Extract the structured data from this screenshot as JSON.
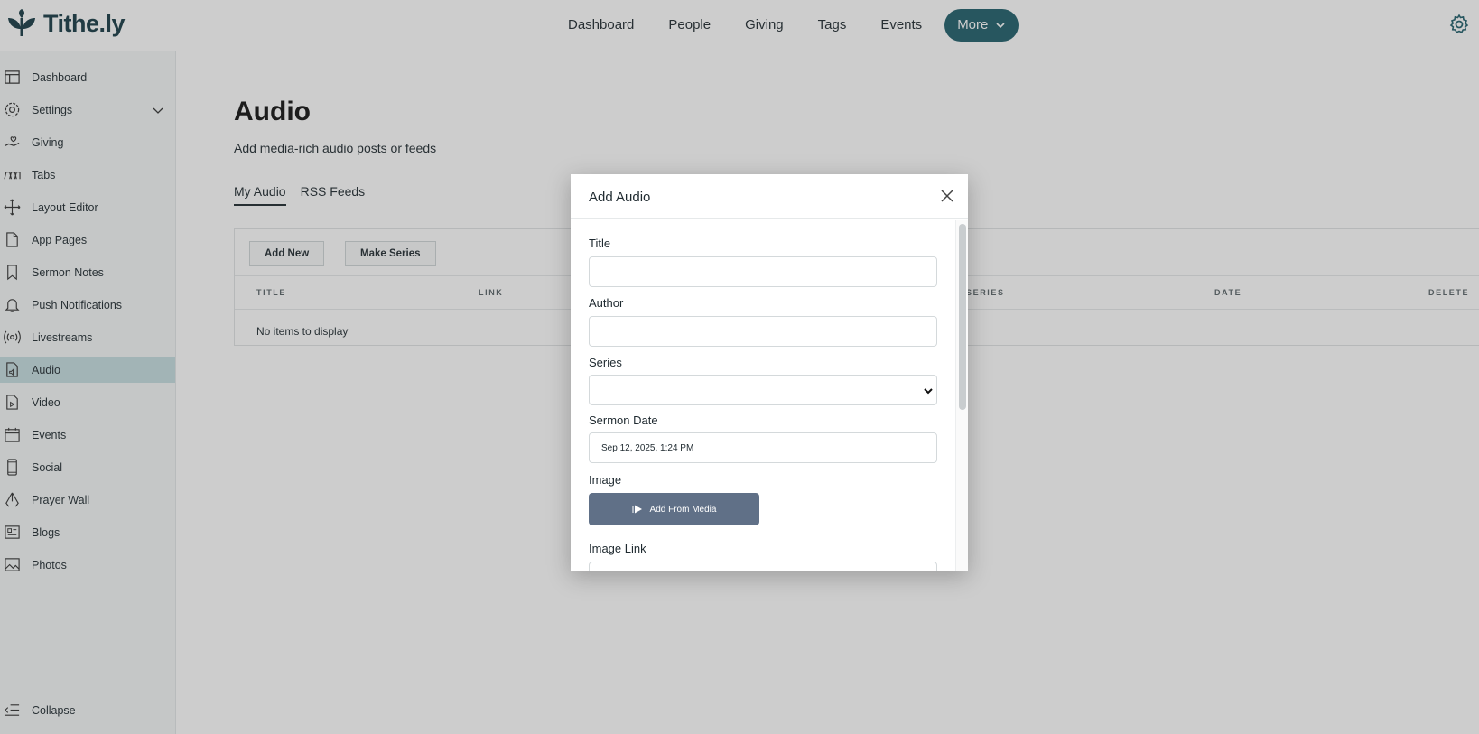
{
  "brand": {
    "name": "Tithe.ly"
  },
  "topnav": {
    "items": [
      "Dashboard",
      "People",
      "Giving",
      "Tags",
      "Events"
    ],
    "more": "More"
  },
  "sidebar": {
    "items": [
      {
        "label": "Dashboard",
        "icon": "layout-icon"
      },
      {
        "label": "Settings",
        "icon": "gear-icon"
      },
      {
        "label": "Giving",
        "icon": "hand-heart-icon"
      },
      {
        "label": "Tabs",
        "icon": "tabs-icon"
      },
      {
        "label": "Layout Editor",
        "icon": "move-icon"
      },
      {
        "label": "App Pages",
        "icon": "file-icon"
      },
      {
        "label": "Sermon Notes",
        "icon": "bookmark-icon"
      },
      {
        "label": "Push Notifications",
        "icon": "bell-icon"
      },
      {
        "label": "Livestreams",
        "icon": "broadcast-icon"
      },
      {
        "label": "Audio",
        "icon": "audio-file-icon"
      },
      {
        "label": "Video",
        "icon": "video-file-icon"
      },
      {
        "label": "Events",
        "icon": "calendar-icon"
      },
      {
        "label": "Social",
        "icon": "phone-icon"
      },
      {
        "label": "Prayer Wall",
        "icon": "praying-hands-icon"
      },
      {
        "label": "Blogs",
        "icon": "news-icon"
      },
      {
        "label": "Photos",
        "icon": "image-icon"
      }
    ],
    "collapse": "Collapse"
  },
  "page": {
    "title": "Audio",
    "subtitle": "Add media-rich audio posts or feeds",
    "tabs": [
      "My Audio",
      "RSS Feeds"
    ],
    "add_new": "Add New",
    "make_series": "Make Series",
    "columns": [
      "TITLE",
      "LINK",
      "SERIES",
      "DATE",
      "DELETE"
    ],
    "empty": "No items to display"
  },
  "modal": {
    "title": "Add Audio",
    "fields": {
      "title": {
        "label": "Title",
        "value": ""
      },
      "author": {
        "label": "Author",
        "value": ""
      },
      "series": {
        "label": "Series",
        "value": ""
      },
      "sermon_date": {
        "label": "Sermon Date",
        "value": "Sep 12, 2025, 1:24 PM"
      },
      "image": {
        "label": "Image",
        "button": "Add From Media"
      },
      "image_link": {
        "label": "Image Link",
        "value": ""
      }
    }
  },
  "colors": {
    "brand": "#173b45",
    "accent": "#1f5f6b",
    "active_sidebar": "#c6dde1",
    "media_button": "#607087"
  }
}
